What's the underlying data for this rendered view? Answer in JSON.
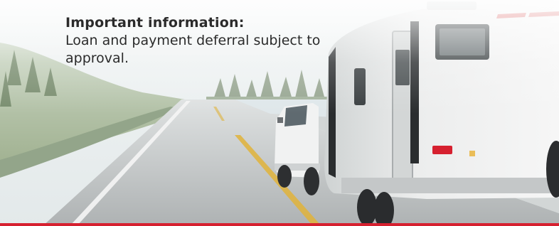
{
  "notice": {
    "heading": "Important information:",
    "body": "Loan and payment deferral subject to approval."
  },
  "image": {
    "subject": "truck-towing-travel-trailer-on-mountain-road"
  },
  "colors": {
    "accent_bar": "#d6202f",
    "text": "#2b2b2b",
    "trailer_body": "#e9eaea",
    "truck_body": "#f3f3f3",
    "road": "#b9bcbd",
    "center_line": "#e0b33a"
  }
}
